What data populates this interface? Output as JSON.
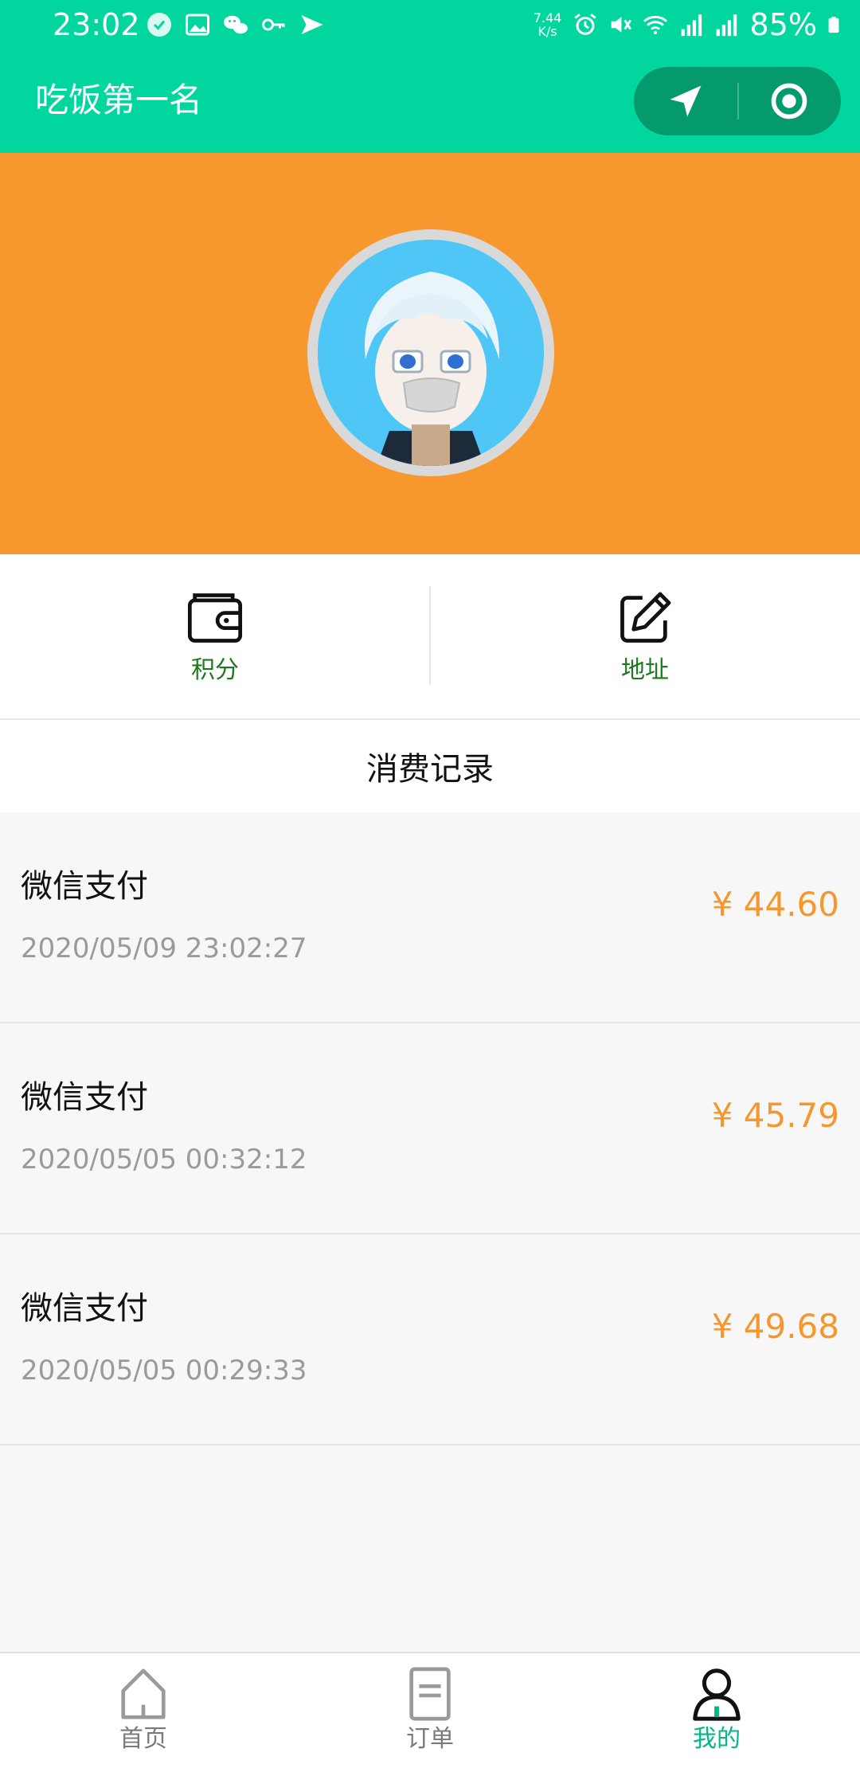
{
  "status_bar": {
    "time": "23:02",
    "net_speed_value": "7.44",
    "net_speed_unit": "K/s",
    "battery": "85%"
  },
  "app": {
    "title": "吃饭第一名"
  },
  "actions": [
    {
      "label": "积分",
      "icon": "wallet-icon"
    },
    {
      "label": "地址",
      "icon": "edit-icon"
    }
  ],
  "section": {
    "title": "消费记录"
  },
  "records": [
    {
      "method": "微信支付",
      "time": "2020/05/09 23:02:27",
      "amount": "¥ 44.60"
    },
    {
      "method": "微信支付",
      "time": "2020/05/05 00:32:12",
      "amount": "¥ 45.79"
    },
    {
      "method": "微信支付",
      "time": "2020/05/05 00:29:33",
      "amount": "¥ 49.68"
    }
  ],
  "tabs": [
    {
      "label": "首页",
      "icon": "home-icon",
      "active": false
    },
    {
      "label": "订单",
      "icon": "order-icon",
      "active": false
    },
    {
      "label": "我的",
      "icon": "user-icon",
      "active": true
    }
  ],
  "colors": {
    "brand": "#02d69f",
    "header": "#f7982f",
    "amount": "#f5972f",
    "action_label": "#1b7a1e",
    "tab_active": "#04b785"
  }
}
